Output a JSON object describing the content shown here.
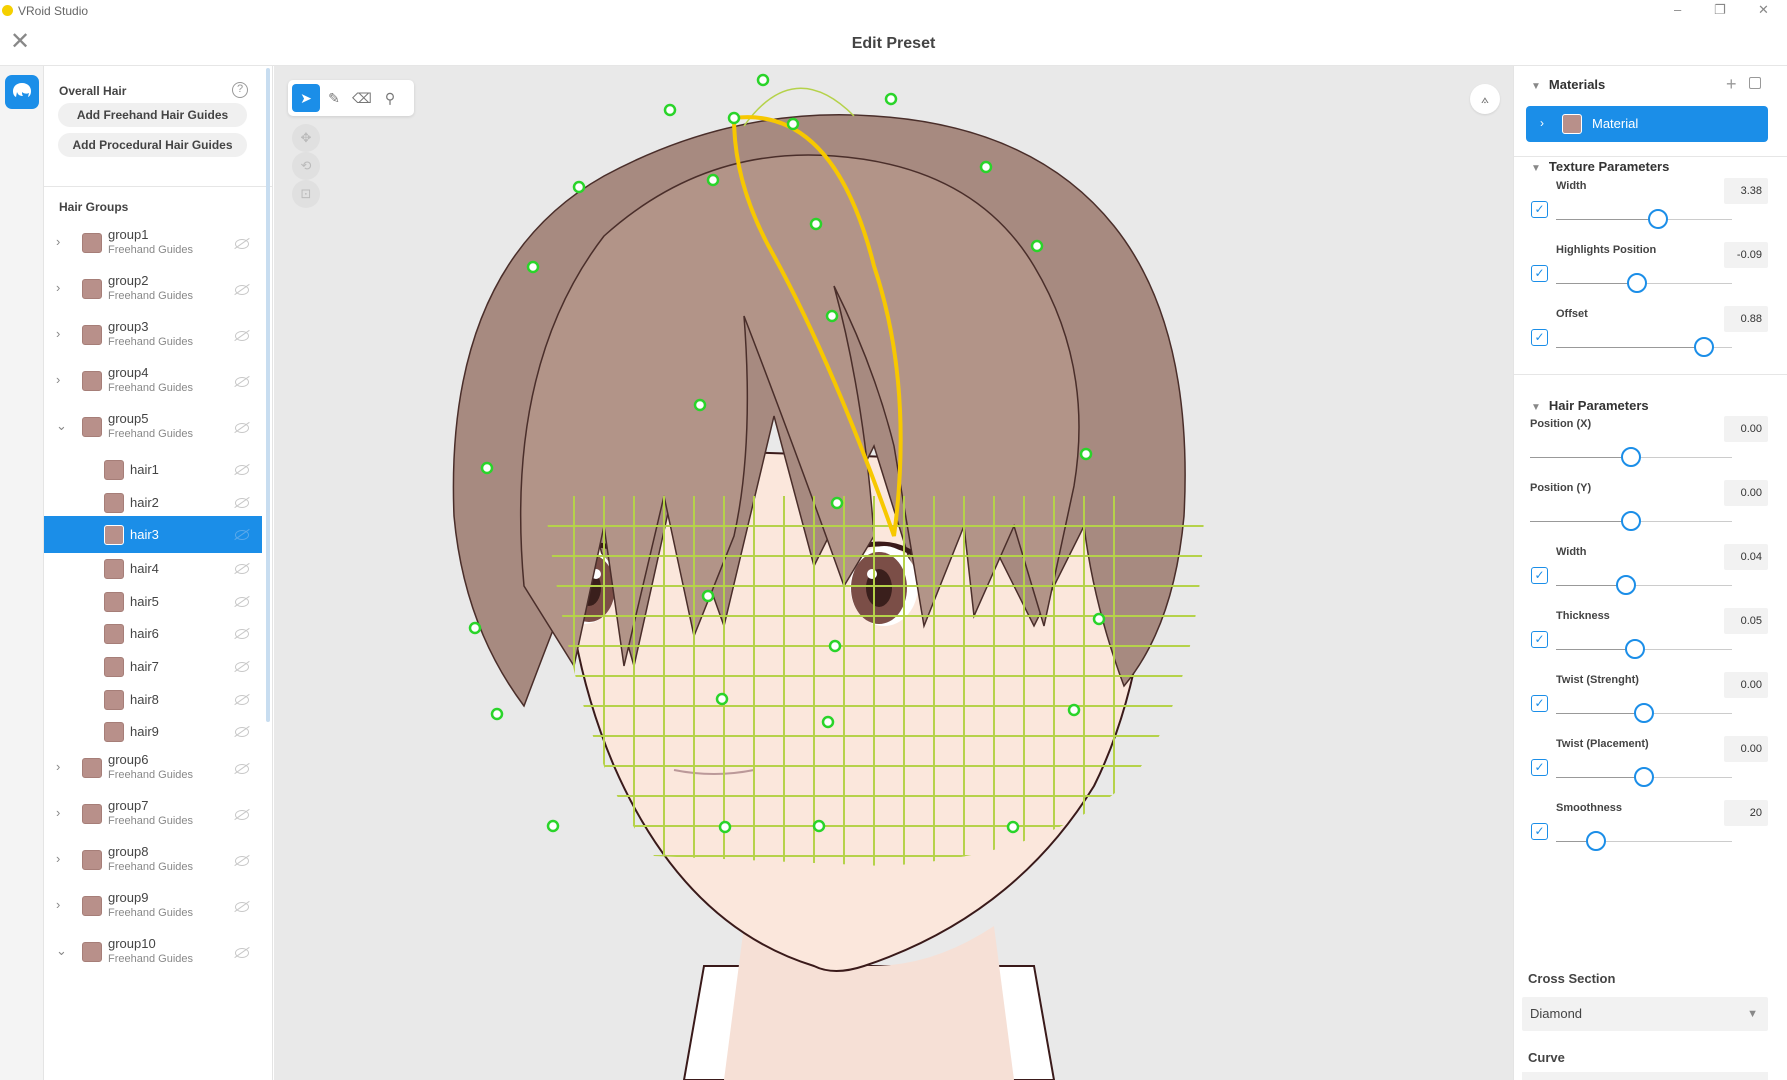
{
  "window": {
    "title": "VRoid Studio",
    "minimize": "–",
    "maximize": "❐",
    "close": "✕"
  },
  "header": {
    "title": "Edit Preset",
    "close": "✕"
  },
  "left_panel": {
    "overall_label": "Overall Hair",
    "help": "?",
    "add_freehand": "Add Freehand Hair Guides",
    "add_procedural": "Add Procedural Hair Guides",
    "groups_label": "Hair Groups",
    "rows": [
      {
        "kind": "group",
        "name": "group1",
        "sub": "Freehand Guides",
        "chev": "›"
      },
      {
        "kind": "group",
        "name": "group2",
        "sub": "Freehand Guides",
        "chev": "›"
      },
      {
        "kind": "group",
        "name": "group3",
        "sub": "Freehand Guides",
        "chev": "›"
      },
      {
        "kind": "group",
        "name": "group4",
        "sub": "Freehand Guides",
        "chev": "›"
      },
      {
        "kind": "group",
        "name": "group5",
        "sub": "Freehand Guides",
        "chev": "⌄"
      },
      {
        "kind": "hair",
        "name": "hair1"
      },
      {
        "kind": "hair",
        "name": "hair2"
      },
      {
        "kind": "hair",
        "name": "hair3",
        "selected": true
      },
      {
        "kind": "hair",
        "name": "hair4"
      },
      {
        "kind": "hair",
        "name": "hair5"
      },
      {
        "kind": "hair",
        "name": "hair6"
      },
      {
        "kind": "hair",
        "name": "hair7"
      },
      {
        "kind": "hair",
        "name": "hair8"
      },
      {
        "kind": "hair",
        "name": "hair9"
      },
      {
        "kind": "group",
        "name": "group6",
        "sub": "Freehand Guides",
        "chev": "›"
      },
      {
        "kind": "group",
        "name": "group7",
        "sub": "Freehand Guides",
        "chev": "›"
      },
      {
        "kind": "group",
        "name": "group8",
        "sub": "Freehand Guides",
        "chev": "›"
      },
      {
        "kind": "group",
        "name": "group9",
        "sub": "Freehand Guides",
        "chev": "›"
      },
      {
        "kind": "group",
        "name": "group10",
        "sub": "Freehand Guides",
        "chev": "⌄"
      }
    ]
  },
  "right_panel": {
    "materials": {
      "label": "Materials",
      "add": "+",
      "item": "Material",
      "chev": "›"
    },
    "texture": {
      "label": "Texture Parameters",
      "params": [
        {
          "label": "Width",
          "value": "3.38",
          "fraction": 0.58,
          "checked": true
        },
        {
          "label": "Highlights Position",
          "value": "-0.09",
          "fraction": 0.46,
          "checked": true
        },
        {
          "label": "Offset",
          "value": "0.88",
          "fraction": 0.84,
          "checked": true
        }
      ]
    },
    "hair": {
      "label": "Hair Parameters",
      "params": [
        {
          "label": "Position (X)",
          "value": "0.00",
          "fraction": 0.5,
          "checked": false
        },
        {
          "label": "Position (Y)",
          "value": "0.00",
          "fraction": 0.5,
          "checked": false
        },
        {
          "label": "Width",
          "value": "0.04",
          "fraction": 0.4,
          "checked": true
        },
        {
          "label": "Thickness",
          "value": "0.05",
          "fraction": 0.45,
          "checked": true
        },
        {
          "label": "Twist (Strenght)",
          "value": "0.00",
          "fraction": 0.5,
          "checked": true
        },
        {
          "label": "Twist (Placement)",
          "value": "0.00",
          "fraction": 0.5,
          "checked": true
        },
        {
          "label": "Smoothness",
          "value": "20",
          "fraction": 0.23,
          "checked": true
        }
      ]
    },
    "cross_section": {
      "label": "Cross Section",
      "value": "Diamond"
    },
    "curve": {
      "label": "Curve"
    }
  },
  "viewport": {
    "tools": [
      "select-tool",
      "pen-tool",
      "eraser-tool",
      "guide-tool"
    ],
    "mirror": "⟑"
  },
  "colors": {
    "accent": "#1b8ee8",
    "hair_swatch": "#b8908a",
    "guide_mesh": "#b5d24a",
    "guide_selected": "#f7c800",
    "control_point": "#2ad42a"
  }
}
